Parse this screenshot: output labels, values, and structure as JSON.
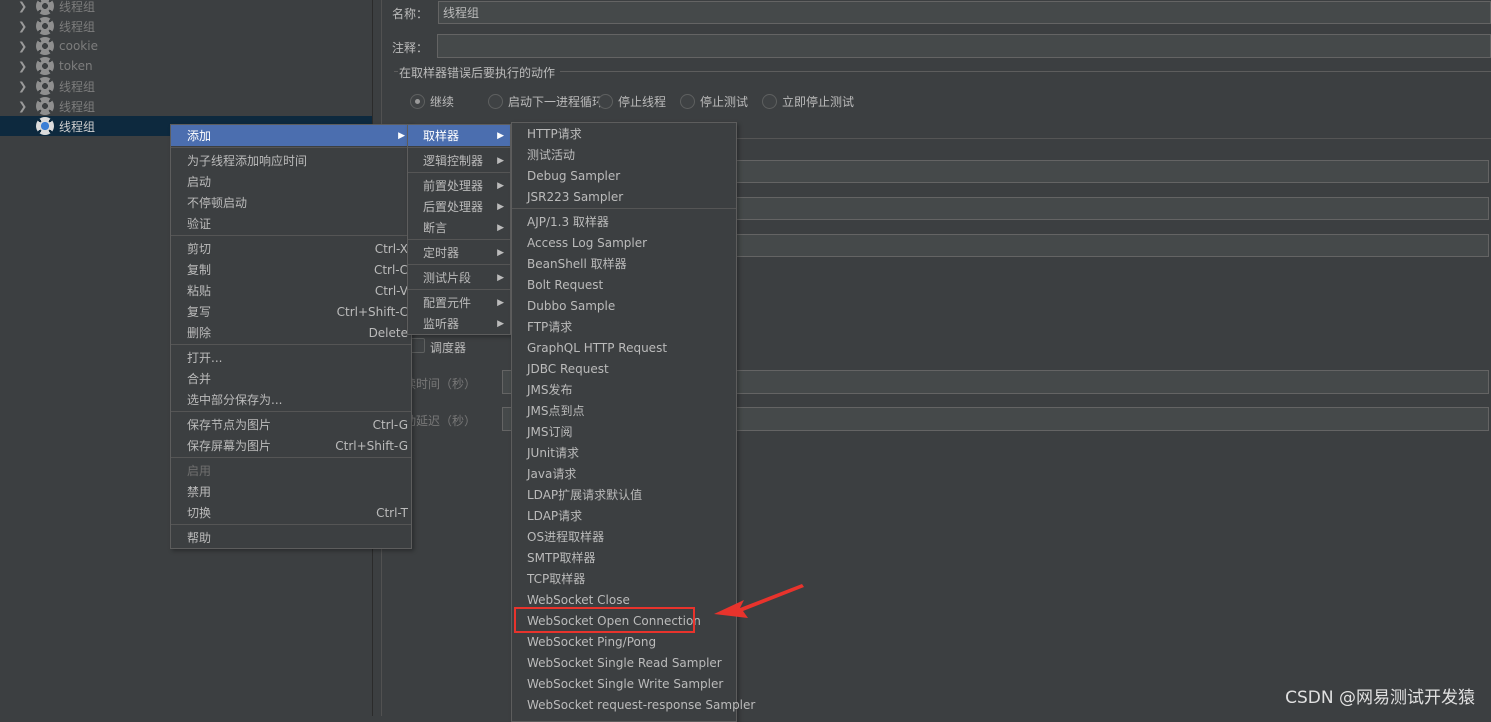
{
  "tree": {
    "nodes": [
      {
        "label": "线程组",
        "expandable": true
      },
      {
        "label": "线程组",
        "expandable": true
      },
      {
        "label": "cookie",
        "expandable": true
      },
      {
        "label": "token",
        "expandable": true
      },
      {
        "label": "线程组",
        "expandable": true
      },
      {
        "label": "线程组",
        "expandable": true
      },
      {
        "label": "线程组",
        "expandable": false,
        "selected": true
      }
    ]
  },
  "form": {
    "name_label": "名称：",
    "name_value": "线程组",
    "comment_label": "注释：",
    "comment_value": "",
    "error_group_label": "在取样器错误后要执行的动作",
    "radios": [
      {
        "label": "继续",
        "checked": true
      },
      {
        "label": "启动下一进程循环",
        "checked": false
      },
      {
        "label": "停止线程",
        "checked": false
      },
      {
        "label": "停止测试",
        "checked": false
      },
      {
        "label": "立即停止测试",
        "checked": false
      }
    ],
    "scheduler_label": "调度器",
    "duration_label": "持续时间（秒）",
    "startup_delay_label": "启动延迟（秒）"
  },
  "context_menu": {
    "groups": [
      [
        {
          "label": "添加",
          "submenu": true,
          "highlighted": true
        }
      ],
      [
        {
          "label": "为子线程添加响应时间"
        },
        {
          "label": "启动"
        },
        {
          "label": "不停顿启动"
        },
        {
          "label": "验证"
        }
      ],
      [
        {
          "label": "剪切",
          "shortcut": "Ctrl-X"
        },
        {
          "label": "复制",
          "shortcut": "Ctrl-C"
        },
        {
          "label": "粘贴",
          "shortcut": "Ctrl-V"
        },
        {
          "label": "复写",
          "shortcut": "Ctrl+Shift-C"
        },
        {
          "label": "删除",
          "shortcut": "Delete"
        }
      ],
      [
        {
          "label": "打开..."
        },
        {
          "label": "合并"
        },
        {
          "label": "选中部分保存为..."
        }
      ],
      [
        {
          "label": "保存节点为图片",
          "shortcut": "Ctrl-G"
        },
        {
          "label": "保存屏幕为图片",
          "shortcut": "Ctrl+Shift-G"
        }
      ],
      [
        {
          "label": "启用",
          "disabled": true
        },
        {
          "label": "禁用"
        },
        {
          "label": "切换",
          "shortcut": "Ctrl-T"
        }
      ],
      [
        {
          "label": "帮助"
        }
      ]
    ]
  },
  "add_submenu": {
    "groups": [
      [
        {
          "label": "取样器",
          "submenu": true,
          "highlighted": true
        }
      ],
      [
        {
          "label": "逻辑控制器",
          "submenu": true
        }
      ],
      [
        {
          "label": "前置处理器",
          "submenu": true
        },
        {
          "label": "后置处理器",
          "submenu": true
        },
        {
          "label": "断言",
          "submenu": true
        }
      ],
      [
        {
          "label": "定时器",
          "submenu": true
        }
      ],
      [
        {
          "label": "测试片段",
          "submenu": true
        }
      ],
      [
        {
          "label": "配置元件",
          "submenu": true
        },
        {
          "label": "监听器",
          "submenu": true
        }
      ]
    ]
  },
  "sampler_submenu": {
    "groups": [
      [
        {
          "label": "HTTP请求"
        },
        {
          "label": "测试活动"
        },
        {
          "label": "Debug Sampler"
        },
        {
          "label": "JSR223 Sampler"
        }
      ],
      [
        {
          "label": "AJP/1.3 取样器"
        },
        {
          "label": "Access Log Sampler"
        },
        {
          "label": "BeanShell 取样器"
        },
        {
          "label": "Bolt Request"
        },
        {
          "label": "Dubbo Sample"
        },
        {
          "label": "FTP请求"
        },
        {
          "label": "GraphQL HTTP Request"
        },
        {
          "label": "JDBC Request"
        },
        {
          "label": "JMS发布"
        },
        {
          "label": "JMS点到点"
        },
        {
          "label": "JMS订阅"
        },
        {
          "label": "JUnit请求"
        },
        {
          "label": "Java请求"
        },
        {
          "label": "LDAP扩展请求默认值"
        },
        {
          "label": "LDAP请求"
        },
        {
          "label": "OS进程取样器"
        },
        {
          "label": "SMTP取样器"
        },
        {
          "label": "TCP取样器"
        },
        {
          "label": "WebSocket Close"
        },
        {
          "label": "WebSocket Open Connection",
          "annotated": true
        },
        {
          "label": "WebSocket Ping/Pong"
        },
        {
          "label": "WebSocket Single Read Sampler"
        },
        {
          "label": "WebSocket Single Write Sampler"
        },
        {
          "label": "WebSocket request-response Sampler"
        }
      ]
    ]
  },
  "annotation_color": "#e8332c",
  "watermark": "CSDN @网易测试开发猿"
}
